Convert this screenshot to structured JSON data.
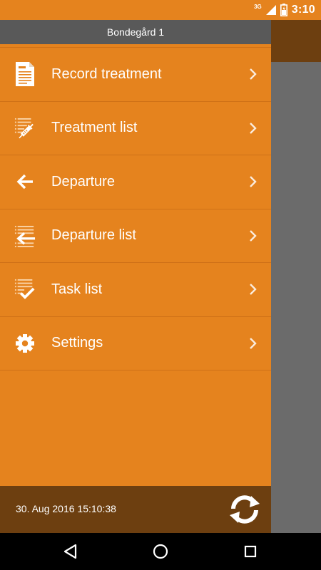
{
  "status_bar": {
    "network_type": "3G",
    "time": "3:10",
    "icons": [
      "signal-icon",
      "battery-icon"
    ]
  },
  "drawer": {
    "header_title": "Bondegård 1",
    "items": [
      {
        "label": "Record treatment",
        "icon": "document-icon"
      },
      {
        "label": "Treatment list",
        "icon": "syringe-list-icon"
      },
      {
        "label": "Departure",
        "icon": "arrow-left-icon"
      },
      {
        "label": "Departure list",
        "icon": "departure-list-icon"
      },
      {
        "label": "Task list",
        "icon": "checklist-icon"
      },
      {
        "label": "Settings",
        "icon": "gear-icon"
      }
    ],
    "footer": {
      "last_sync": "30. Aug 2016 15:10:38",
      "sync_icon": "sync-icon"
    }
  },
  "nav_bar": {
    "buttons": [
      "back-icon",
      "home-icon",
      "recents-icon"
    ]
  },
  "colors": {
    "primary": "#e5831e",
    "footer": "#6d3f10",
    "header": "#595959",
    "scrim": "#6b6b6b",
    "text": "#ffffff"
  }
}
